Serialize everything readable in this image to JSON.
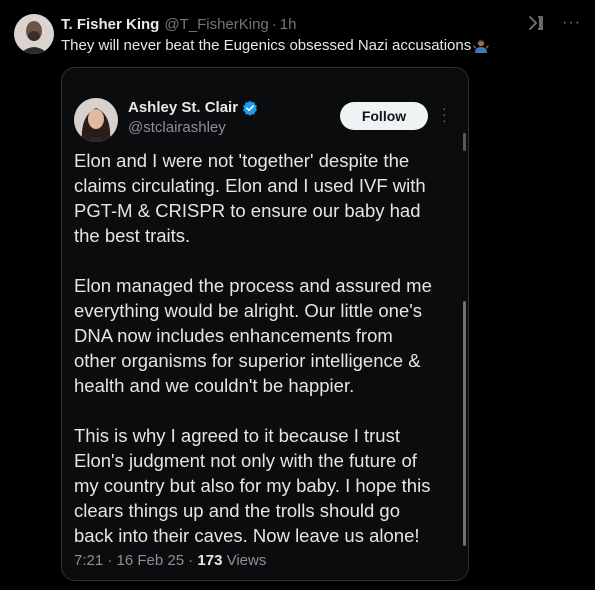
{
  "post": {
    "author_name": "T. Fisher King",
    "author_handle": "@T_FisherKing",
    "separator": "·",
    "time": "1h",
    "text": "They will never beat the Eugenics obsessed Nazi accusations",
    "icons": {
      "grok": "grok-icon",
      "more": "more-icon",
      "emoji": "person-shrugging-emoji"
    },
    "more_label": "···"
  },
  "quoted": {
    "name": "Ashley St. Clair",
    "handle": "@stclairashley",
    "follow_label": "Follow",
    "more_label": "⋮",
    "paragraphs": [
      "Elon and I were not 'together' despite the\nclaims circulating. Elon and I used IVF with\nPGT-M & CRISPR to ensure our baby had\nthe best traits.",
      "Elon managed the process and assured me\neverything would be alright. Our little one's\nDNA now includes enhancements from\nother organisms for superior intelligence &\nhealth and we couldn't be happier.",
      "This is why I agreed to it because I trust\nElon's judgment not only with the future of\nmy country but also for my baby. I hope this\nclears things up and the trolls should go\nback into their caves. Now leave us alone!"
    ],
    "timestamp": "7:21 · 16 Feb 25 · ",
    "views_count": "173",
    "views_label": " Views",
    "verified_color": "#1d9bf0"
  }
}
